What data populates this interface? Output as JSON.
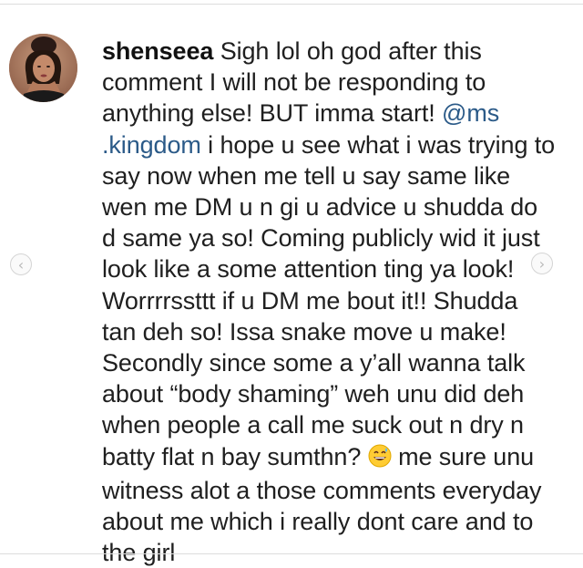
{
  "comment": {
    "username": "shenseea",
    "text_part1": " Sigh lol oh god after this comment I will not be responding to anything else! BUT imma start! ",
    "mention": "@ms .kingdom",
    "text_part2": " i hope u see what i was trying to say now when me tell u say same like wen me DM u n gi u advice u shudda do d same ya so! Coming publicly wid it just look like a some attention ting ya look! Worrrrssttt if u DM me bout it!! Shudda tan deh so! Issa snake move u make! Secondly since some a y’all wanna talk about “body shaming” weh unu did deh when people a call me suck out n dry n batty flat n bay sumthn? ",
    "text_part3": " me sure unu witness alot a those comments everyday about me which i really dont care and to the girl",
    "emoji_icon": "grinning-sweat-emoji"
  },
  "nav": {
    "prev_icon": "chevron-left-icon",
    "next_icon": "chevron-right-icon",
    "prev_glyph": "‹",
    "next_glyph": "›"
  },
  "colors": {
    "mention": "#2b5a88",
    "text": "#1f1f1f"
  }
}
